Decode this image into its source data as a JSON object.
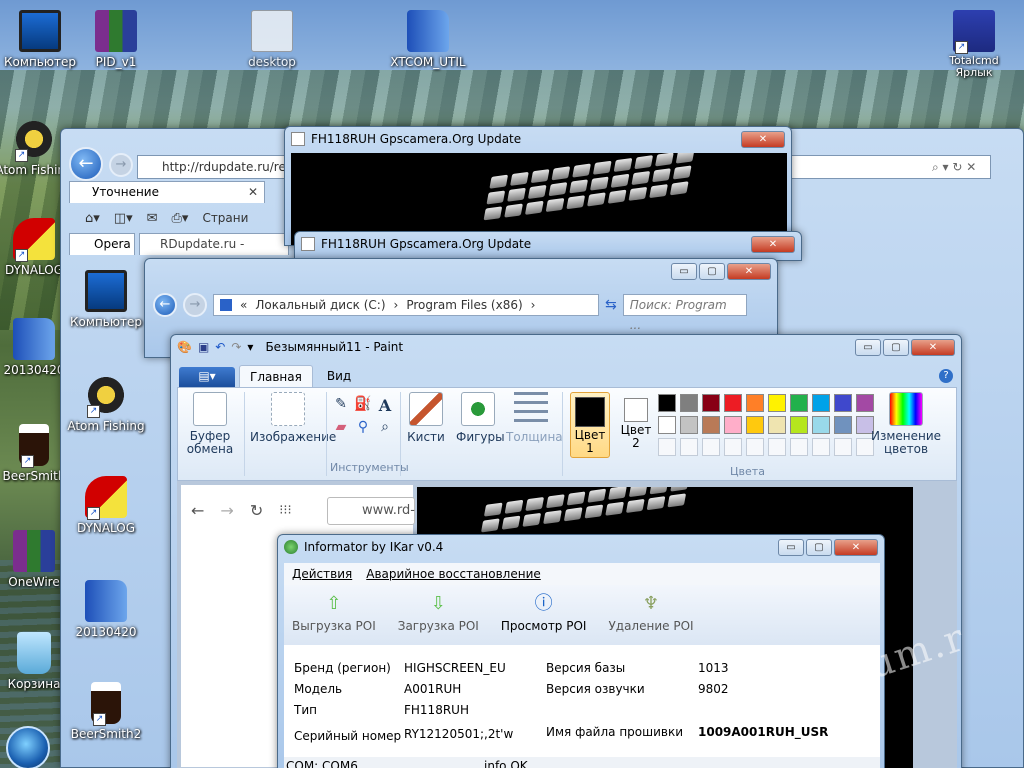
{
  "desktop": {
    "icons_top": [
      {
        "label": "Компьютер",
        "kind": "computer"
      },
      {
        "label": "PID_v1",
        "kind": "rar"
      },
      {
        "label": "desktop",
        "kind": "doc"
      },
      {
        "label": "XTCOM_UTIL",
        "kind": "folder"
      },
      {
        "label": "Totalcmd Ярлык",
        "kind": "floppy"
      }
    ],
    "icons_left": [
      {
        "label": "Atom Fishing",
        "kind": "fish"
      },
      {
        "label": "DYNALOG",
        "kind": "dyna"
      },
      {
        "label": "20130420",
        "kind": "folder"
      },
      {
        "label": "BeerSmith",
        "kind": "beer"
      },
      {
        "label": "OneWire",
        "kind": "rar"
      },
      {
        "label": "Корзина",
        "kind": "bin"
      }
    ],
    "icons_second": [
      {
        "label": "Компьютер",
        "kind": "computer"
      },
      {
        "label": "Atom Fishing",
        "kind": "fish"
      },
      {
        "label": "DYNALOG",
        "kind": "dyna"
      },
      {
        "label": "20130420",
        "kind": "folder"
      },
      {
        "label": "BeerSmith2",
        "kind": "beer"
      }
    ],
    "watermark": "rd-forum.r"
  },
  "ie": {
    "address": "http://rdupdate.ru/rea",
    "tab": "Уточнение",
    "tab_close": "✕",
    "toolbar_page": "Страни",
    "tab2": "Opera",
    "tab3": "RDupdate.ru - сервис о"
  },
  "gps1": {
    "title": "FH118RUH  Gpscamera.Org Update",
    "close": "✕"
  },
  "gps2": {
    "title": "FH118RUH  Gpscamera.Org Update",
    "close": "✕"
  },
  "explorer": {
    "crumbs": [
      "«",
      "Локальный диск (C:)",
      "›",
      "Program Files (x86)",
      "›"
    ],
    "search_placeholder": "Поиск: Program ...",
    "min": "▭",
    "max": "▢",
    "close": "✕"
  },
  "paint": {
    "title": "Безымянный11 - Paint",
    "tabs": {
      "home": "Главная",
      "view": "Вид"
    },
    "groups": {
      "clipboard": "Буфер обмена",
      "image": "Изображение",
      "tools": "Инструменты",
      "brushes": "Кисти",
      "shapes": "Фигуры",
      "size": "Толщина",
      "color1": "Цвет 1",
      "color2": "Цвет 2",
      "colors": "Цвета",
      "edit_colors": "Изменение цветов"
    },
    "palette_row1": [
      "#000000",
      "#7f7f7f",
      "#880015",
      "#ed1c24",
      "#ff7f27",
      "#fff200",
      "#22b14c",
      "#00a2e8",
      "#3f48cc",
      "#a349a4"
    ],
    "palette_row2": [
      "#ffffff",
      "#c3c3c3",
      "#b97a57",
      "#ffaec9",
      "#ffc90e",
      "#efe4b0",
      "#b5e61d",
      "#99d9ea",
      "#7092be",
      "#c8bfe7"
    ],
    "browser_url": "www.rd-",
    "tools_text": "A"
  },
  "informator": {
    "title": "Informator by IKar v0.4",
    "menu": [
      "Действия",
      "Аварийное восстановление"
    ],
    "tools": [
      {
        "label": "Выгрузка POI",
        "icon": "upload-arrow-icon",
        "glyph": "⇧",
        "color": "#5cbf4a"
      },
      {
        "label": "Загрузка POI",
        "icon": "download-arrow-icon",
        "glyph": "⇩",
        "color": "#5cbf4a"
      },
      {
        "label": "Просмотр POI",
        "icon": "info-icon",
        "glyph": "ⓘ",
        "color": "#1a63c7"
      },
      {
        "label": "Удаление POI",
        "icon": "broom-icon",
        "glyph": "♆",
        "color": "#8aa060"
      }
    ],
    "fields": {
      "brand_label": "Бренд (регион)",
      "brand_value": "HIGHSCREEN_EU",
      "model_label": "Модель",
      "model_value": "A001RUH",
      "type_label": "Тип",
      "type_value": "FH118RUH",
      "serial_label": "Серийный номер",
      "serial_value": "RY12120501;,2t'w",
      "db_label": "Версия базы",
      "db_value": "1013",
      "voice_label": "Версия озвучки",
      "voice_value": "9802",
      "fw_label": "Имя файла прошивки",
      "fw_value": "1009A001RUH_USR"
    },
    "status": {
      "com": "COM: COM6",
      "info": "info OK"
    }
  }
}
